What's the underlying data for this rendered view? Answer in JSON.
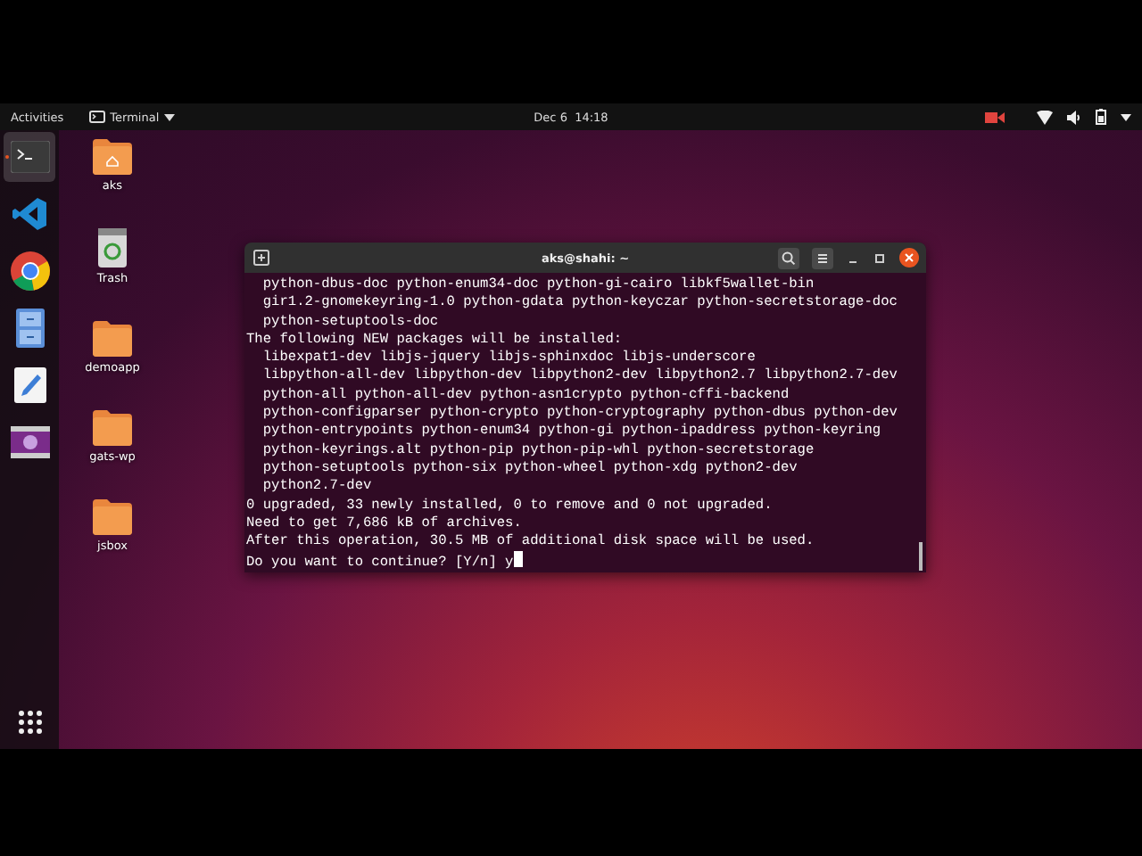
{
  "top_bar": {
    "activities": "Activities",
    "app_menu": "Terminal",
    "clock": "Dec 6  14:18"
  },
  "dock": [
    {
      "kind": "terminal",
      "selected": true
    },
    {
      "kind": "code",
      "selected": false
    },
    {
      "kind": "browser",
      "selected": false
    },
    {
      "kind": "files",
      "selected": false
    },
    {
      "kind": "editor",
      "selected": false
    },
    {
      "kind": "video",
      "selected": false
    }
  ],
  "desktop_icons": [
    {
      "kind": "home",
      "label": "aks"
    },
    {
      "kind": "trash",
      "label": "Trash"
    },
    {
      "kind": "folder",
      "label": "demoapp"
    },
    {
      "kind": "folder",
      "label": "gats-wp"
    },
    {
      "kind": "folder",
      "label": "jsbox"
    }
  ],
  "terminal": {
    "title": "aks@shahi: ~",
    "lines": [
      "  python-dbus-doc python-enum34-doc python-gi-cairo libkf5wallet-bin",
      "  gir1.2-gnomekeyring-1.0 python-gdata python-keyczar python-secretstorage-doc",
      "  python-setuptools-doc",
      "The following NEW packages will be installed:",
      "  libexpat1-dev libjs-jquery libjs-sphinxdoc libjs-underscore",
      "  libpython-all-dev libpython-dev libpython2-dev libpython2.7 libpython2.7-dev",
      "  python-all python-all-dev python-asn1crypto python-cffi-backend",
      "  python-configparser python-crypto python-cryptography python-dbus python-dev",
      "  python-entrypoints python-enum34 python-gi python-ipaddress python-keyring",
      "  python-keyrings.alt python-pip python-pip-whl python-secretstorage",
      "  python-setuptools python-six python-wheel python-xdg python2-dev",
      "  python2.7-dev",
      "0 upgraded, 33 newly installed, 0 to remove and 0 not upgraded.",
      "Need to get 7,686 kB of archives.",
      "After this operation, 30.5 MB of additional disk space will be used."
    ],
    "prompt": "Do you want to continue? [Y/n] ",
    "input": "y"
  }
}
